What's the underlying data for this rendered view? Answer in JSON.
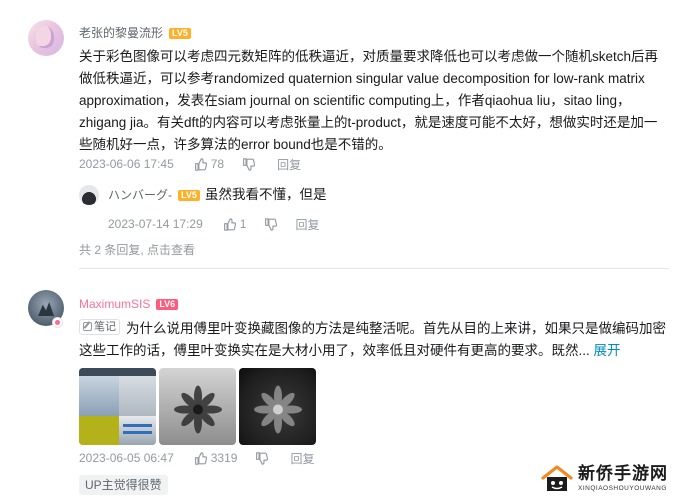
{
  "comments": [
    {
      "username": "老张的黎曼流形",
      "level": "LV5",
      "text": "关于彩色图像可以考虑四元数矩阵的低秩逼近，对质量要求降低也可以考虑做一个随机sketch后再做低秩逼近，可以参考randomized quaternion singular value decomposition for low-rank matrix approximation，发表在siam journal on scientific computing上，作者qiaohua liu，sitao ling，zhigang jia。有关dft的内容可以考虑张量上的t-product，就是速度可能不太好，想做实时还是加一些随机好一点，许多算法的error bound也是不错的。",
      "time": "2023-06-06 17:45",
      "likes": "78",
      "reply_label": "回复",
      "reply": {
        "username": "ハンバーグ-",
        "level": "LV5",
        "text": "虽然我看不懂，但是",
        "time": "2023-07-14 17:29",
        "likes": "1",
        "reply_label": "回复"
      },
      "reply_count_text": "共 2 条回复,",
      "reply_count_click": "点击查看"
    },
    {
      "username": "MaximumSIS",
      "level": "LV6",
      "note_tag": "笔记",
      "text": "为什么说用傅里叶变换藏图像的方法是纯整活呢。首先从目的上来讲，如果只是做编码加密这些工作的话，傅里叶变换实在是大材小用了，效率低且对硬件有更高的要求。既然...",
      "expand_label": "展开",
      "images": [
        "screenshot-collage",
        "gray-flower",
        "dark-flower"
      ],
      "time": "2023-06-05 06:47",
      "likes": "3319",
      "reply_label": "回复",
      "up_tag": "UP主觉得很赞"
    }
  ],
  "watermark": {
    "title": "新侨手游网",
    "subtitle": "XINQIAOSHOUYOUWANG"
  },
  "colors": {
    "accent_pink": "#fb7299",
    "link_blue": "#008ac5",
    "meta_gray": "#9499a0",
    "lv5": "#ffb027",
    "lv6": "#ff5c7c"
  }
}
